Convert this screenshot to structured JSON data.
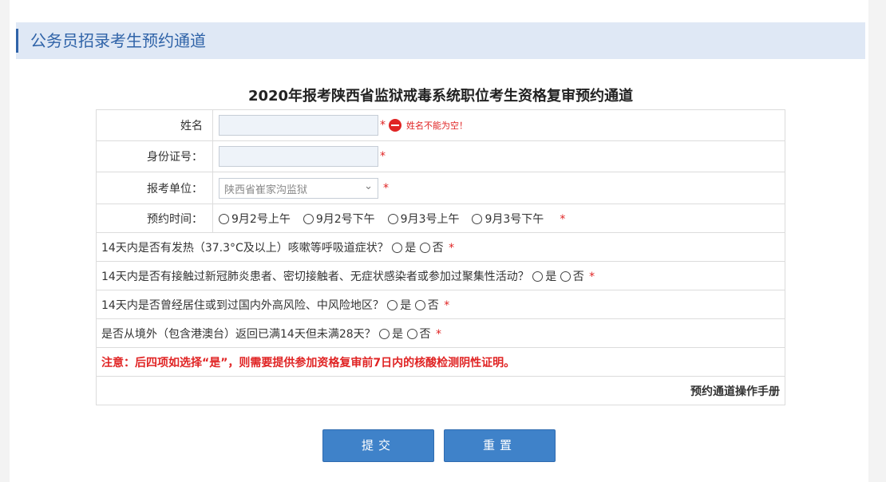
{
  "header": {
    "title": "公务员招录考生预约通道"
  },
  "form": {
    "title": "2020年报考陕西省监狱戒毒系统职位考生资格复审预约通道",
    "required_mark": "*",
    "name": {
      "label": "姓名",
      "value": "",
      "error": "姓名不能为空！"
    },
    "id_number": {
      "label": "身份证号：",
      "value": ""
    },
    "unit": {
      "label": "报考单位：",
      "selected": "陕西省崔家沟监狱"
    },
    "appointment": {
      "label": "预约时间：",
      "options": [
        "9月2号上午",
        "9月2号下午",
        "9月3号上午",
        "9月3号下午"
      ]
    },
    "yes_label": "是",
    "no_label": "否",
    "questions": [
      "14天内是否有发热（37.3°C及以上）咳嗽等呼吸道症状？",
      "14天内是否有接触过新冠肺炎患者、密切接触者、无症状感染者或参加过聚集性活动？",
      "14天内是否曾经居住或到过国内外高风险、中风险地区？",
      "是否从境外（包含港澳台）返回已满14天但未满28天？"
    ],
    "note": "注意：后四项如选择“是”，则需要提供参加资格复审前7日内的核酸检测阴性证明。",
    "manual_link": "预约通道操作手册"
  },
  "buttons": {
    "submit": "提交",
    "reset": "重置"
  },
  "colors": {
    "accent": "#2f63a8",
    "header_bg": "#dfe8f5",
    "button": "#3f82c9",
    "error": "#e02424"
  }
}
